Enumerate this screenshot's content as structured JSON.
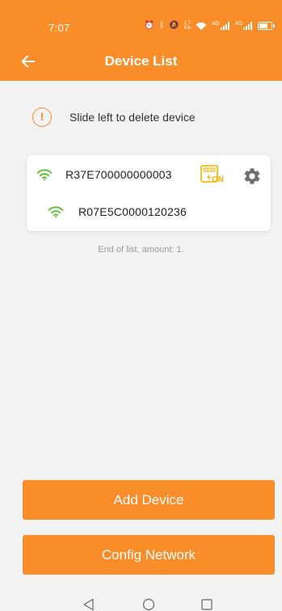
{
  "status_bar": {
    "time": "7:07",
    "speed_value": "1.7",
    "speed_unit": "K/s",
    "signal_label_1": "4G",
    "signal_label_2": "4G"
  },
  "header": {
    "title": "Device List",
    "back_icon": "arrow-left-icon"
  },
  "notice": {
    "icon": "exclamation-circle-icon",
    "text": "Slide left to delete device"
  },
  "devices": [
    {
      "name": "R37E700000000003",
      "icon": "wifi-icon",
      "badge_label": "ON",
      "badge_icon": "power-on-badge-icon",
      "settings_icon": "gear-icon"
    },
    {
      "name": "R07E5C0000120236",
      "icon": "wifi-icon"
    }
  ],
  "list_footer": "End of list, amount: 1.",
  "buttons": {
    "add_device": "Add Device",
    "config_network": "Config Network"
  },
  "colors": {
    "primary": "#f98d2a",
    "wifi": "#5fc43c",
    "badge": "#f0b400",
    "gear": "#6f6f6f"
  }
}
